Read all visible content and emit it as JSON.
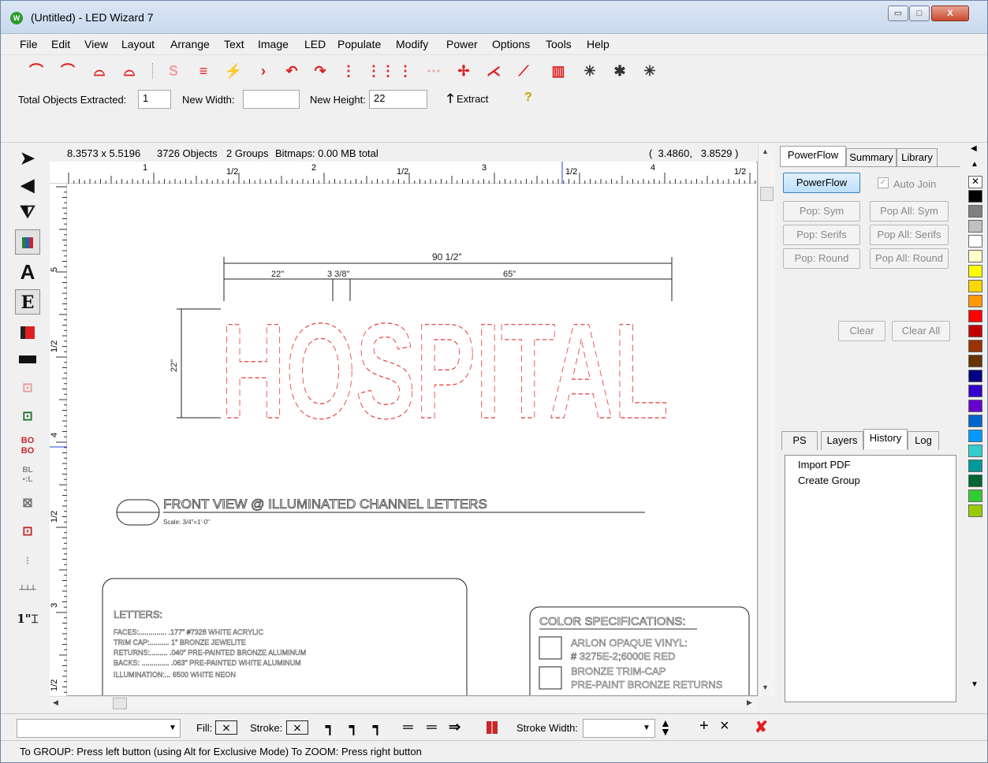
{
  "window": {
    "title": "(Untitled) - LED Wizard 7",
    "app_icon": "W",
    "controls": {
      "minimize": "▭",
      "maximize": "□",
      "close": "X"
    }
  },
  "menu": [
    "File",
    "Edit",
    "View",
    "Layout",
    "Arrange",
    "Text",
    "Image",
    "LED",
    "Populate",
    "Modify",
    "Power",
    "Options",
    "Tools",
    "Help"
  ],
  "toolbar": {
    "icons": [
      "bridge-icon",
      "bridge-small-icon",
      "arch-icon",
      "arch-small-icon",
      "s-curve-icon",
      "double-bar-icon",
      "zigzag-icon",
      "chevron-icon",
      "arrow-curve-icon",
      "arrow-back-icon",
      "dotted-comb-icon",
      "dotted-line-icon",
      "dotted-line-small-icon",
      "dash-dot-icon",
      "plus-stars-icon",
      "node-join-icon",
      "node-curve-icon",
      "grid-h-icon",
      "x-star-icon",
      "x-star-bold-icon",
      "x-star-red-icon"
    ]
  },
  "extract": {
    "total_label": "Total Objects Extracted:",
    "total_value": "1",
    "width_label": "New Width:",
    "width_value": "",
    "height_label": "New Height:",
    "height_value": "22",
    "extract_button": "Extract",
    "help_glyph": "?"
  },
  "canvas_status": {
    "size": "8.3573 x 5.5196",
    "objects": "3726 Objects",
    "groups": "2 Groups",
    "bitmaps": "Bitmaps: 0.00 MB total",
    "coords": "(  3.4860,   3.8529 )"
  },
  "ruler": {
    "h_labels": [
      "1",
      "1/2",
      "2",
      "1/2",
      "3",
      "1/2",
      "4",
      "1/2"
    ],
    "v_labels": [
      "5",
      "1/2",
      "4",
      "1/2",
      "3",
      "1/2"
    ]
  },
  "drawing": {
    "word": "HOSPITAL",
    "dim_total": "90 1/2\"",
    "dim_a": "22\"",
    "dim_b": "3 3/8\"",
    "dim_c": "65\"",
    "dim_height": "22\"",
    "front_view": "FRONT VIEW  @ ILLUMINATED CHANNEL LETTERS",
    "scale": "Scale: 3/4\"=1'-0\"",
    "letters_title": "LETTERS:",
    "letters_lines": [
      "FACES:.............. .177\" #7328 WHITE ACRYLIC",
      "TRIM CAP:.......... 1\" BRONZE JEWELITE",
      "RETURNS:......... .040\" PRE-PAINTED BRONZE ALUMINUM",
      "BACKS: .............. .063\" PRE-PAINTED WHITE ALUMINUM",
      "ILLUMINATION:... 6500 WHITE NEON"
    ],
    "color_title": "COLOR SPECIFICATIONS:",
    "color_line1a": "ARLON OPAQUE VINYL:",
    "color_line1b": "# 3275E-2;6000E  RED",
    "color_line2a": "BRONZE TRIM-CAP",
    "color_line2b": "PRE-PAINT BRONZE RETURNS"
  },
  "right_panel": {
    "tabs_top": [
      "PowerFlow",
      "Summary",
      "Library"
    ],
    "powerflow_button": "PowerFlow",
    "auto_join": "Auto Join",
    "buttons": [
      "Pop: Sym",
      "Pop All: Sym",
      "Pop: Serifs",
      "Pop All: Serifs",
      "Pop: Round",
      "Pop All: Round"
    ],
    "clear": "Clear",
    "clear_all": "Clear All",
    "tabs_bottom": [
      "PS",
      "Layers",
      "History",
      "Log"
    ],
    "history": [
      "Import PDF",
      "Create Group"
    ]
  },
  "palette": [
    "#000000",
    "#808080",
    "#c0c0c0",
    "#ffffff",
    "#ffffcc",
    "#ffff00",
    "#ffd700",
    "#ff9900",
    "#ff0000",
    "#c00000",
    "#993300",
    "#663300",
    "#000080",
    "#3300cc",
    "#6600cc",
    "#0066cc",
    "#0099ff",
    "#33cccc",
    "#009999",
    "#006633",
    "#33cc33",
    "#99cc00"
  ],
  "bottom": {
    "fill_label": "Fill:",
    "stroke_label": "Stroke:",
    "stroke_width_label": "Stroke Width:",
    "plus": "+",
    "times": "×",
    "red_x": "✘"
  },
  "statusbar": "To GROUP: Press left button (using Alt for Exclusive Mode)  To ZOOM: Press right button",
  "colors": {
    "accent_red": "#e02020",
    "link_blue": "#3c7fb1"
  }
}
